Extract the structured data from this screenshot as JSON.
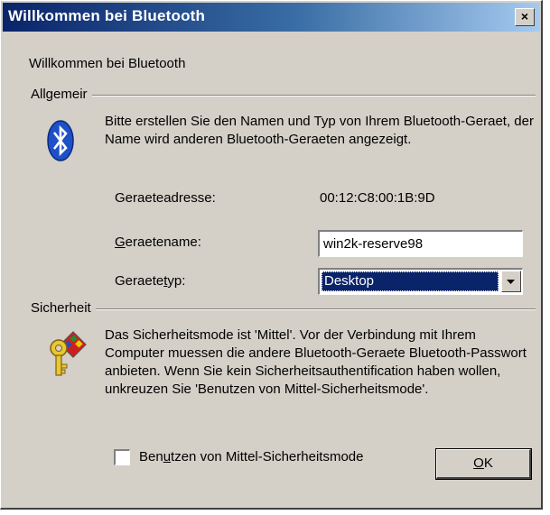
{
  "window": {
    "title": "Willkommen bei Bluetooth",
    "close_label": "×"
  },
  "header": {
    "text": "Willkommen bei Bluetooth"
  },
  "general": {
    "legend": "Allgemeir",
    "description": "Bitte erstellen Sie den Namen und Typ von Ihrem Bluetooth-Geraet, der Name wird anderen Bluetooth-Geraeten angezeigt.",
    "address_label": "Geraeteadresse:",
    "address_value": "00:12:C8:00:1B:9D",
    "name_label_mnemonic": "G",
    "name_label_rest": "eraetename:",
    "name_value": "win2k-reserve98",
    "type_label_pre": "Geraete",
    "type_label_mnemonic": "t",
    "type_label_post": "yp:",
    "type_value": "Desktop"
  },
  "security": {
    "legend": "Sicherheit",
    "description": "Das Sicherheitsmode ist 'Mittel'. Vor der Verbindung mit Ihrem Computer muessen die andere Bluetooth-Geraete Bluetooth-Passwort anbieten. Wenn Sie kein Sicherheitsauthentification haben wollen, unkreuzen Sie 'Benutzen von Mittel-Sicherheitsmode'.",
    "checkbox_pre": "Ben",
    "checkbox_mnemonic": "u",
    "checkbox_post": "tzen von Mittel-Sicherheitsmode",
    "checkbox_checked": false
  },
  "buttons": {
    "ok_mnemonic": "O",
    "ok_rest": "K"
  },
  "colors": {
    "titlebar_start": "#0a246a",
    "titlebar_end": "#a6caf0",
    "dialog_bg": "#d4d0c8",
    "selection": "#0a246a",
    "bluetooth_blue": "#1e50c8"
  },
  "icons": {
    "bluetooth": "bluetooth-icon",
    "security": "key-shield-icon"
  }
}
